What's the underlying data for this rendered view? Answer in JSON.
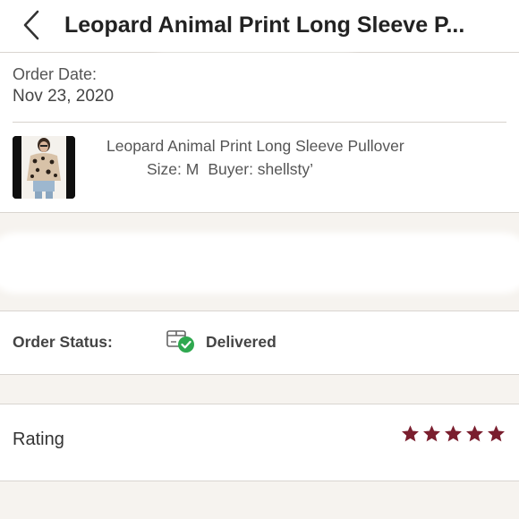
{
  "header": {
    "back_icon": "chevron-left-icon",
    "title": "Leopard Animal Print Long Sleeve P..."
  },
  "order": {
    "date_label": "Order Date:",
    "date_value": "Nov 23, 2020",
    "product": {
      "name": "Leopard Animal Print Long Sleeve Pullover",
      "size": "Size: M",
      "buyer": "Buyer: shellsty’"
    }
  },
  "status": {
    "label": "Order Status:",
    "icon": "package-delivered-icon",
    "value": "Delivered",
    "check_color": "#2fa84f"
  },
  "rating": {
    "label": "Rating",
    "stars": 5,
    "max_stars": 5,
    "star_color": "#7a1e2e"
  }
}
